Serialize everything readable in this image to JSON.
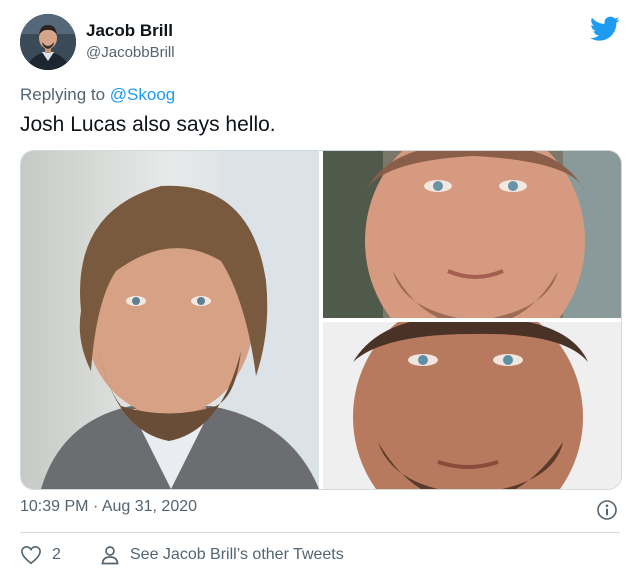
{
  "user": {
    "display_name": "Jacob Brill",
    "handle": "@JacobbBrill",
    "avatar_alt": "profile-photo"
  },
  "reply": {
    "prefix": "Replying to",
    "mention": "@Skoog"
  },
  "tweet": {
    "text": "Josh Lucas also says hello.",
    "time": "10:39 PM",
    "separator": "·",
    "date": "Aug 31, 2020"
  },
  "actions": {
    "like_count": "2",
    "see_more_label": "See Jacob Brill’s other Tweets"
  },
  "colors": {
    "twitter_blue": "#1d9bf0",
    "secondary_text": "#536471",
    "primary_text": "#0f1419"
  },
  "icons": {
    "brand": "twitter-bird-icon",
    "info": "info-icon",
    "like": "heart-icon",
    "profile": "person-icon"
  }
}
